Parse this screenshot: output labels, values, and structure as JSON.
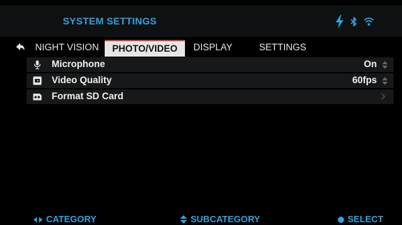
{
  "header": {
    "title": "SYSTEM SETTINGS",
    "status_icons": [
      "bolt-icon",
      "bluetooth-icon",
      "wifi-icon"
    ],
    "accent_color": "#2ea3e0",
    "status_color": "#2ea3e0"
  },
  "tabs": {
    "items": [
      {
        "label": "NIGHT VISION",
        "active": false
      },
      {
        "label": "PHOTO/VIDEO",
        "active": true
      },
      {
        "label": "DISPLAY",
        "active": false
      },
      {
        "label": "SETTINGS",
        "active": false
      }
    ],
    "active_indicator_color": "#d0432c"
  },
  "settings": {
    "rows": [
      {
        "icon": "microphone-icon",
        "label": "Microphone",
        "value": "On",
        "control": "updown-icon"
      },
      {
        "icon": "video-quality-icon",
        "label": "Video Quality",
        "value": "60fps",
        "control": "updown-icon"
      },
      {
        "icon": "sd-card-icon",
        "label": "Format SD Card",
        "value": "",
        "control": "chevron-right-icon"
      }
    ]
  },
  "footer": {
    "category": "CATEGORY",
    "subcategory": "SUBCATEGORY",
    "select": "SELECT"
  }
}
